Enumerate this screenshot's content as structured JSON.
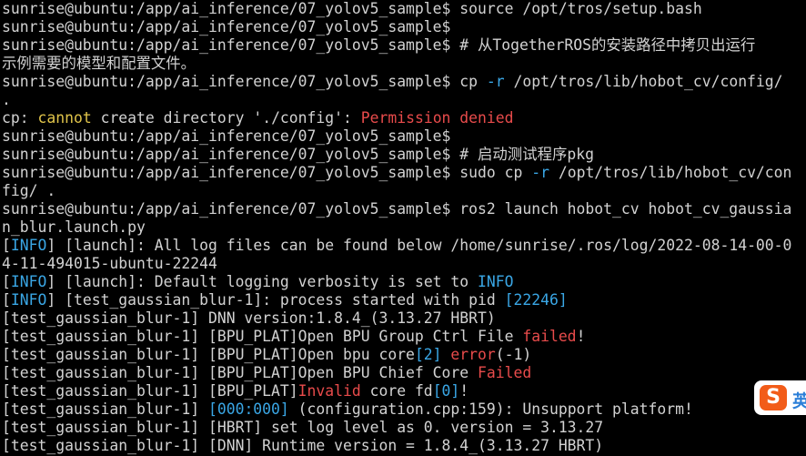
{
  "colors": {
    "background": "#000000",
    "default": "#d2d2d2",
    "red": "#e84b4b",
    "yellow": "#e0c44a",
    "cyan": "#3aa7e6",
    "ime_logo": "#f25c19",
    "ime_mode": "#2b7fd8"
  },
  "terminal": {
    "lines": [
      [
        {
          "t": "sunrise@ubuntu:/app/ai_inference/07_yolov5_sample$ source /opt/tros/setup.bash",
          "c": "default"
        }
      ],
      [
        {
          "t": "sunrise@ubuntu:/app/ai_inference/07_yolov5_sample$",
          "c": "default"
        }
      ],
      [
        {
          "t": "sunrise@ubuntu:/app/ai_inference/07_yolov5_sample$ # 从TogetherROS的安装路径中拷贝出运行",
          "c": "default"
        }
      ],
      [
        {
          "t": "示例需要的模型和配置文件。",
          "c": "default"
        }
      ],
      [
        {
          "t": "sunrise@ubuntu:/app/ai_inference/07_yolov5_sample$ cp ",
          "c": "default"
        },
        {
          "t": "-r",
          "c": "cyan"
        },
        {
          "t": " /opt/tros/lib/hobot_cv/config/",
          "c": "default"
        }
      ],
      [
        {
          "t": ".",
          "c": "default"
        }
      ],
      [
        {
          "t": "cp: ",
          "c": "default"
        },
        {
          "t": "cannot",
          "c": "yellow"
        },
        {
          "t": " create directory './config': ",
          "c": "default"
        },
        {
          "t": "Permission denied",
          "c": "red"
        }
      ],
      [
        {
          "t": "sunrise@ubuntu:/app/ai_inference/07_yolov5_sample$",
          "c": "default"
        }
      ],
      [
        {
          "t": "sunrise@ubuntu:/app/ai_inference/07_yolov5_sample$ # 启动测试程序pkg",
          "c": "default"
        }
      ],
      [
        {
          "t": "sunrise@ubuntu:/app/ai_inference/07_yolov5_sample$ sudo cp ",
          "c": "default"
        },
        {
          "t": "-r",
          "c": "cyan"
        },
        {
          "t": " /opt/tros/lib/hobot_cv/con",
          "c": "default"
        }
      ],
      [
        {
          "t": "fig/ .",
          "c": "default"
        }
      ],
      [
        {
          "t": "sunrise@ubuntu:/app/ai_inference/07_yolov5_sample$ ros2 launch hobot_cv hobot_cv_gaussia",
          "c": "default"
        }
      ],
      [
        {
          "t": "n_blur.launch.py",
          "c": "default"
        }
      ],
      [
        {
          "t": "[",
          "c": "default"
        },
        {
          "t": "INFO",
          "c": "cyan"
        },
        {
          "t": "] [launch]: All log files can be found below /home/sunrise/.ros/log/2022-08-14-00-0",
          "c": "default"
        }
      ],
      [
        {
          "t": "4-11-494015-ubuntu-22244",
          "c": "default"
        }
      ],
      [
        {
          "t": "[",
          "c": "default"
        },
        {
          "t": "INFO",
          "c": "cyan"
        },
        {
          "t": "] [launch]: Default logging verbosity is set to ",
          "c": "default"
        },
        {
          "t": "INFO",
          "c": "cyan"
        }
      ],
      [
        {
          "t": "[",
          "c": "default"
        },
        {
          "t": "INFO",
          "c": "cyan"
        },
        {
          "t": "] [test_gaussian_blur-1]: process started with pid ",
          "c": "default"
        },
        {
          "t": "[22246]",
          "c": "cyan"
        }
      ],
      [
        {
          "t": "[test_gaussian_blur-1] DNN version:1.8.4_(3.13.27 HBRT)",
          "c": "default"
        }
      ],
      [
        {
          "t": "[test_gaussian_blur-1] [BPU_PLAT]Open BPU Group Ctrl File ",
          "c": "default"
        },
        {
          "t": "failed",
          "c": "red"
        },
        {
          "t": "!",
          "c": "default"
        }
      ],
      [
        {
          "t": "[test_gaussian_blur-1] [BPU_PLAT]Open bpu core",
          "c": "default"
        },
        {
          "t": "[2]",
          "c": "cyan"
        },
        {
          "t": " ",
          "c": "default"
        },
        {
          "t": "error",
          "c": "red"
        },
        {
          "t": "(-1)",
          "c": "default"
        }
      ],
      [
        {
          "t": "[test_gaussian_blur-1] [BPU_PLAT]Open BPU Chief Core ",
          "c": "default"
        },
        {
          "t": "Failed",
          "c": "red"
        }
      ],
      [
        {
          "t": "[test_gaussian_blur-1] [BPU_PLAT]",
          "c": "default"
        },
        {
          "t": "Invalid",
          "c": "red"
        },
        {
          "t": " core fd",
          "c": "default"
        },
        {
          "t": "[0]",
          "c": "cyan"
        },
        {
          "t": "!",
          "c": "default"
        }
      ],
      [
        {
          "t": "[test_gaussian_blur-1] ",
          "c": "default"
        },
        {
          "t": "[000:000]",
          "c": "cyan"
        },
        {
          "t": " (configuration.cpp:159): Unsupport platform!",
          "c": "default"
        }
      ],
      [
        {
          "t": "[test_gaussian_blur-1] [HBRT] set log level as 0. version = 3.13.27",
          "c": "default"
        }
      ],
      [
        {
          "t": "[test_gaussian_blur-1] [DNN] Runtime version = 1.8.4_(3.13.27 HBRT)",
          "c": "default"
        }
      ]
    ]
  },
  "ime": {
    "logo_glyph": "S",
    "mode_label": "英",
    "logo_icon": "sogou-ime-logo-icon"
  }
}
